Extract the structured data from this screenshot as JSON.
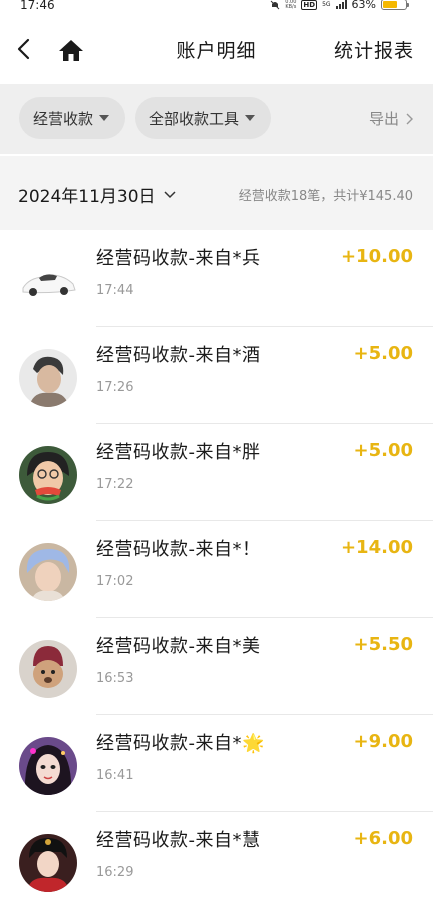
{
  "status_bar": {
    "time": "17:46",
    "net_speed": "0.00\nKB/s",
    "hd": "HD",
    "network": "5G",
    "battery_percent": "63%",
    "battery_level": 0.63
  },
  "nav": {
    "title": "账户明细",
    "report_label": "统计报表"
  },
  "filters": {
    "type_label": "经营收款",
    "tool_label": "全部收款工具",
    "export_label": "导出"
  },
  "date_section": {
    "date": "2024年11月30日",
    "summary": "经营收款18笔，共计¥145.40"
  },
  "transactions": [
    {
      "name": "经营码收款-来自*兵",
      "time": "17:44",
      "amount": "+10.00"
    },
    {
      "name": "经营码收款-来自*酒",
      "time": "17:26",
      "amount": "+5.00"
    },
    {
      "name": "经营码收款-来自*胖",
      "time": "17:22",
      "amount": "+5.00"
    },
    {
      "name": "经营码收款-来自*！",
      "time": "17:02",
      "amount": "+14.00"
    },
    {
      "name": "经营码收款-来自*美",
      "time": "16:53",
      "amount": "+5.50"
    },
    {
      "name": "经营码收款-来自*🌟",
      "time": "16:41",
      "amount": "+9.00"
    },
    {
      "name": "经营码收款-来自*慧",
      "time": "16:29",
      "amount": "+6.00"
    }
  ],
  "colors": {
    "amount": "#e8b512",
    "filter_bg": "#efefef",
    "date_bg": "#f4f4f4"
  }
}
